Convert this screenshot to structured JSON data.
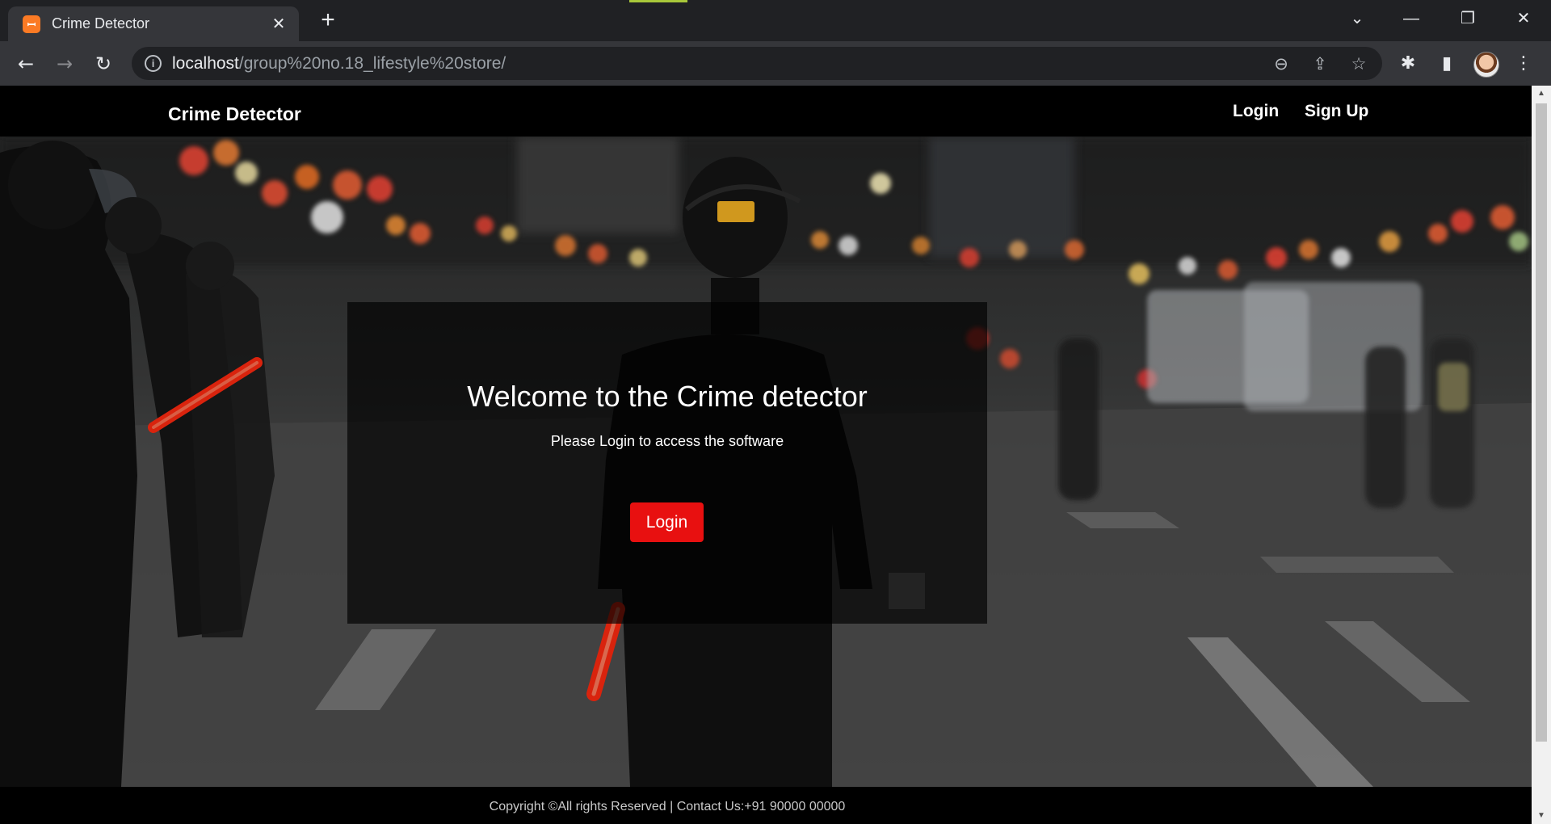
{
  "browser": {
    "tab": {
      "title": "Crime Detector",
      "favicon": "xampp-icon",
      "favicon_glyph": "ꟷ",
      "close_glyph": "✕"
    },
    "new_tab_glyph": "+",
    "window_controls": {
      "tab_search_glyph": "⌄",
      "minimize_glyph": "—",
      "restore_glyph": "❐",
      "close_glyph": "✕"
    },
    "nav": {
      "back_glyph": "←",
      "forward_glyph": "→",
      "reload_glyph": "↻"
    },
    "address": {
      "host": "localhost",
      "path": "/group%20no.18_lifestyle%20store/",
      "info_glyph": "i"
    },
    "omnibox_icons": {
      "zoom_glyph": "⊖",
      "share_glyph": "⇪",
      "bookmark_glyph": "☆"
    },
    "toolbar_icons": {
      "extensions_glyph": "✱",
      "sidepanel_glyph": "▮",
      "menu_glyph": "⋮"
    }
  },
  "page": {
    "navbar": {
      "brand": "Crime Detector",
      "links": {
        "login": "Login",
        "signup": "Sign Up"
      }
    },
    "hero": {
      "title": "Welcome to the Crime detector",
      "subtitle": "Please Login to access the software",
      "login_button": "Login"
    },
    "footer": {
      "text": "Copyright ©All rights Reserved | Contact Us:+91 90000 00000"
    }
  },
  "colors": {
    "accent": "#e81010",
    "navbar_bg": "#000000",
    "overlay": "rgba(0,0,0,0.68)"
  }
}
